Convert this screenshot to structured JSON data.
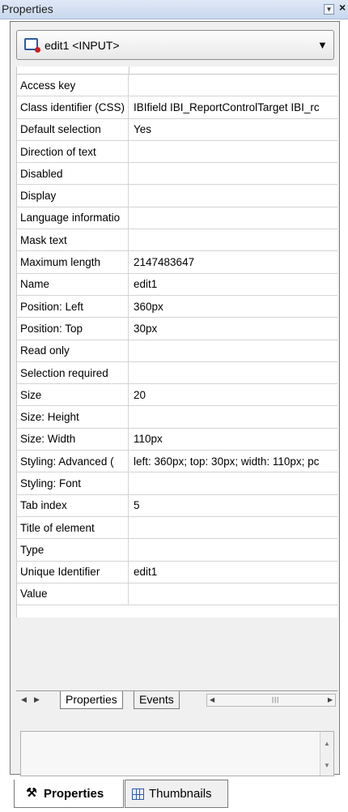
{
  "window": {
    "title": "Properties"
  },
  "combo": {
    "selected": "edit1 <INPUT>"
  },
  "properties": [
    {
      "name": "Access key",
      "value": ""
    },
    {
      "name": "Class identifier (CSS)",
      "value": "IBIfield IBI_ReportControlTarget  IBI_rc"
    },
    {
      "name": "Default selection",
      "value": "Yes"
    },
    {
      "name": "Direction of text",
      "value": ""
    },
    {
      "name": "Disabled",
      "value": ""
    },
    {
      "name": "Display",
      "value": ""
    },
    {
      "name": "Language informatio",
      "value": ""
    },
    {
      "name": "Mask text",
      "value": ""
    },
    {
      "name": "Maximum length",
      "value": "2147483647"
    },
    {
      "name": "Name",
      "value": "edit1"
    },
    {
      "name": "Position: Left",
      "value": "360px"
    },
    {
      "name": "Position: Top",
      "value": "30px"
    },
    {
      "name": "Read only",
      "value": ""
    },
    {
      "name": "Selection required",
      "value": ""
    },
    {
      "name": "Size",
      "value": "20"
    },
    {
      "name": "Size: Height",
      "value": ""
    },
    {
      "name": "Size: Width",
      "value": "110px"
    },
    {
      "name": "Styling: Advanced (",
      "value": "left: 360px; top: 30px; width: 110px; pc"
    },
    {
      "name": "Styling: Font",
      "value": ""
    },
    {
      "name": "Tab index",
      "value": "5"
    },
    {
      "name": "Title of element",
      "value": ""
    },
    {
      "name": "Type",
      "value": ""
    },
    {
      "name": "Unique Identifier",
      "value": "edit1"
    },
    {
      "name": "Value",
      "value": ""
    }
  ],
  "tabs": {
    "properties": "Properties",
    "events": "Events"
  },
  "bottom_tabs": {
    "properties": "Properties",
    "thumbnails": "Thumbnails"
  },
  "icons": {
    "dropdown": "chevron-down-icon",
    "close": "close-icon",
    "element": "input-element-icon",
    "properties": "properties-icon",
    "thumbnails": "thumbnails-icon"
  }
}
